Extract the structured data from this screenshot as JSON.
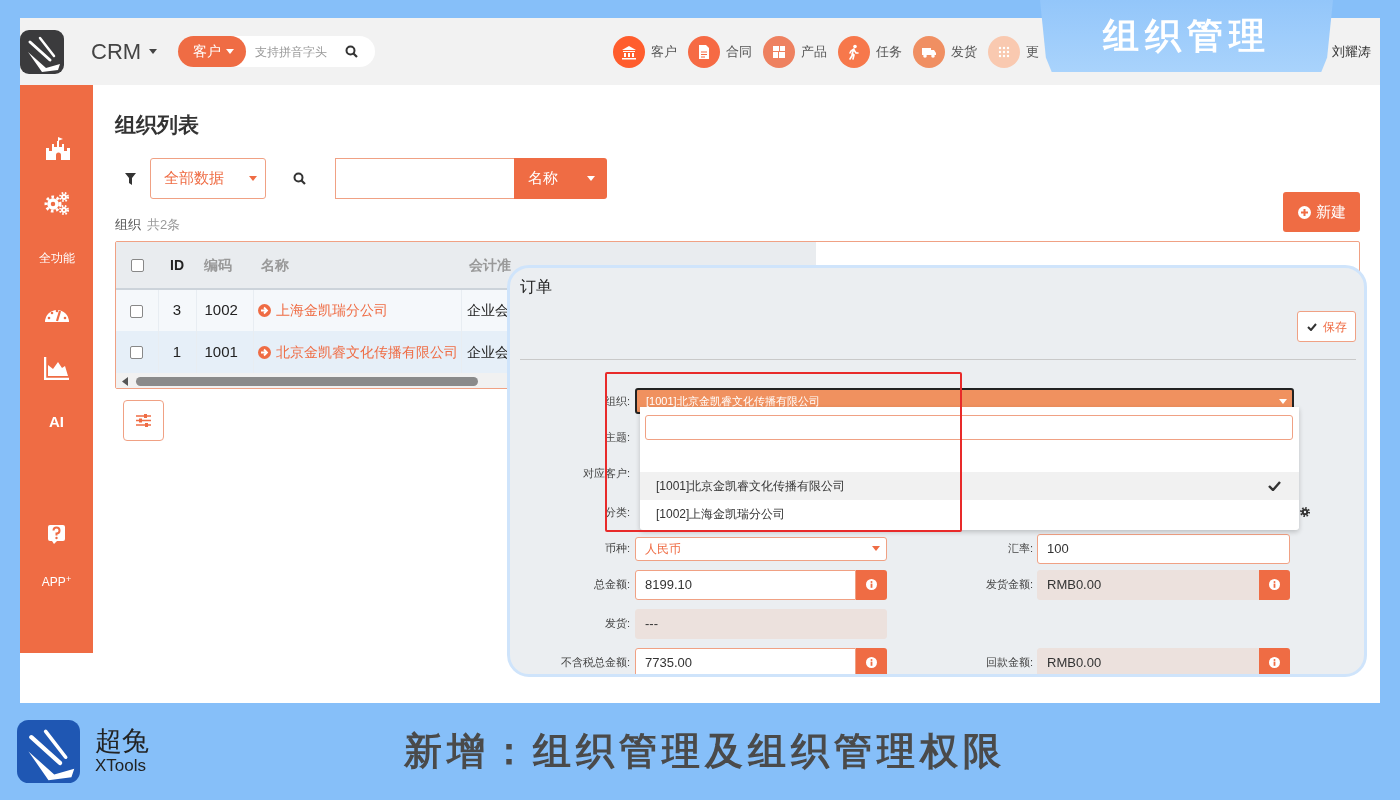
{
  "badge_tab": "组织管理",
  "navbar": {
    "app_menu": "CRM",
    "search": {
      "scope": "客户",
      "placeholder": "支持拼音字头"
    },
    "shortcuts": [
      {
        "label": "客户",
        "color": "#ff5d2d"
      },
      {
        "label": "合同",
        "color": "#f66a44"
      },
      {
        "label": "产品",
        "color": "#ee8160"
      },
      {
        "label": "任务",
        "color": "#f7784b"
      },
      {
        "label": "发货",
        "color": "#f08f62"
      },
      {
        "label": "更",
        "color": "#f9c9b0"
      }
    ],
    "user": "刘耀涛"
  },
  "sidebar": {
    "labels": [
      "全功能",
      "AI",
      "APP$^{+}$"
    ]
  },
  "page": {
    "title": "组织列表",
    "filter": "全部数据",
    "search_field": "名称",
    "new_button": "新建",
    "caption": {
      "entity": "组织",
      "count": "共2条"
    }
  },
  "table": {
    "all_checked": false,
    "columns": [
      "ID",
      "编码",
      "名称",
      "会计准"
    ],
    "rows": [
      {
        "checked": false,
        "cells": [
          "3",
          "1002",
          "上海金凯瑞分公司",
          "企业会"
        ]
      },
      {
        "checked": false,
        "cells": [
          "1",
          "1001",
          "北京金凯睿文化传播有限公司",
          "企业会"
        ]
      }
    ]
  },
  "dialog": {
    "title": "订单",
    "save": "保存",
    "org": {
      "label": "组织:",
      "value": "[1001]北京金凯睿文化传播有限公司",
      "expanded": true
    },
    "dropdown": {
      "options": [
        {
          "label": "[1001]北京金凯睿文化传播有限公司",
          "selected": true
        },
        {
          "label": "[1002]上海金凯瑞分公司",
          "selected": false
        }
      ]
    },
    "covered_labels": [
      "主题:",
      "对应客户:",
      "分类:"
    ],
    "rows": [
      [
        {
          "label": "币种:",
          "kind": "select",
          "value": "人民币"
        },
        {
          "label": "汇率:",
          "kind": "input",
          "value": "100"
        }
      ],
      [
        {
          "label": "总金额:",
          "kind": "input",
          "value": "8199.10",
          "info": true
        },
        {
          "label": "发货金额:",
          "kind": "readonly",
          "value": "RMB0.00",
          "info": true
        }
      ],
      [
        {
          "label": "发货:",
          "kind": "readonly",
          "value": "---"
        }
      ],
      [
        {
          "label": "不含税总金额:",
          "kind": "input",
          "value": "7735.00",
          "info": true
        },
        {
          "label": "回款金额:",
          "kind": "readonly",
          "value": "RMB0.00",
          "info": true
        }
      ]
    ]
  },
  "footer": {
    "brand": "超兔",
    "brand_en": "XTools",
    "headline": "新增：组织管理及组织管理权限"
  }
}
